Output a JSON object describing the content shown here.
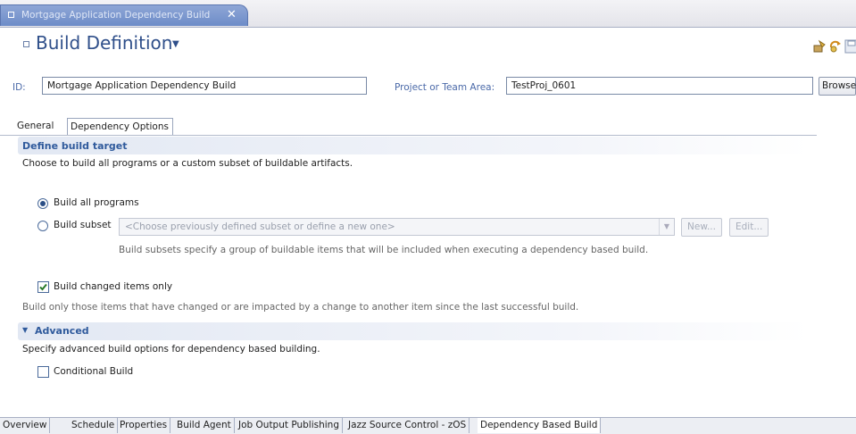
{
  "editor": {
    "tab_title": "Mortgage Application Dependency Build",
    "close_glyph": "✕"
  },
  "header": {
    "title": "Build Definition",
    "dropdown_glyph": "▼",
    "toolbar_icons": [
      "build-request-icon",
      "refresh-icon",
      "save-icon"
    ]
  },
  "id_row": {
    "id_label": "ID:",
    "id_value": "Mortgage Application Dependency Build",
    "project_label": "Project or Team Area:",
    "project_value": "TestProj_0601",
    "browse_label": "Browse"
  },
  "inner_tabs": [
    {
      "label": "General",
      "active": false
    },
    {
      "label": "Dependency Options",
      "active": true
    }
  ],
  "define_target": {
    "title": "Define build target",
    "description": "Choose to build all programs or a custom subset of buildable artifacts.",
    "build_all_label": "Build all programs",
    "build_all_selected": true,
    "build_subset_label": "Build subset",
    "subset_placeholder": "<Choose previously defined subset or define a new one>",
    "new_button": "New...",
    "edit_button": "Edit...",
    "subset_help": "Build subsets specify a group of buildable items that will be included when executing a dependency based build.",
    "changed_only_label": "Build changed items only",
    "changed_only_checked": true,
    "changed_only_help": "Build only those items that have changed or are impacted by a change to another item since the last successful build."
  },
  "advanced": {
    "title": "Advanced",
    "twisty_glyph": "▼",
    "description": "Specify advanced build options for dependency based building.",
    "conditional_label": "Conditional Build",
    "conditional_checked": false
  },
  "bottom_tabs": [
    {
      "label": "Overview",
      "active": false
    },
    {
      "label": "Schedule",
      "active": false
    },
    {
      "label": "Properties",
      "active": false
    },
    {
      "label": "Build Agent",
      "active": false
    },
    {
      "label": "Job Output Publishing",
      "active": false
    },
    {
      "label": "Jazz Source Control - zOS",
      "active": false
    },
    {
      "label": "Dependency Based Build",
      "active": true
    }
  ],
  "colors": {
    "accent": "#2f4f8a",
    "section_title": "#2f5a9c",
    "tab_blue": "#7a96cf"
  }
}
